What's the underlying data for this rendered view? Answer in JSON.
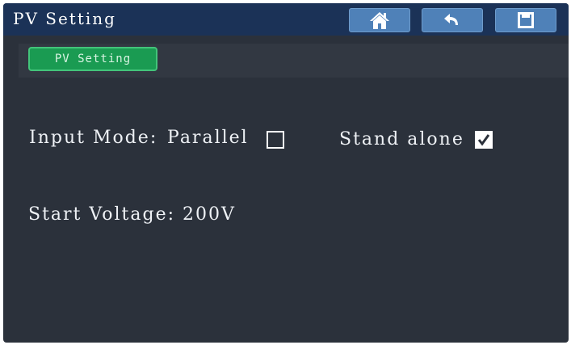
{
  "header": {
    "title": "PV Setting",
    "buttons": [
      {
        "icon": "home-icon"
      },
      {
        "icon": "back-arrow-icon"
      },
      {
        "icon": "save-icon"
      }
    ]
  },
  "tabs": [
    {
      "label": "PV Setting",
      "active": true
    }
  ],
  "input_mode": {
    "label": "Input Mode:",
    "options": [
      {
        "label": "Parallel",
        "checked": false
      },
      {
        "label": "Stand alone",
        "checked": true
      }
    ]
  },
  "start_voltage": {
    "text": "Start Voltage: 200V"
  },
  "colors": {
    "background": "#2b313b",
    "titlebar": "#1b3257",
    "button": "#4f81b8",
    "tab_active": "#1a9b52"
  }
}
